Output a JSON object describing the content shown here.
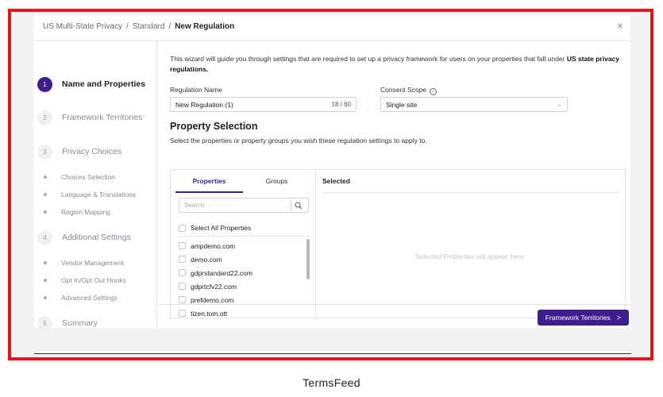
{
  "breadcrumb": {
    "item1": "US Multi-State Privacy",
    "sep": "/",
    "item2": "Standard",
    "current": "New Regulation"
  },
  "close_icon": "×",
  "steps": [
    {
      "num": "1",
      "label": "Name and Properties"
    },
    {
      "num": "2",
      "label": "Framework Territories"
    },
    {
      "num": "3",
      "label": "Privacy Choices"
    },
    {
      "num": "4",
      "label": "Additional Settings"
    },
    {
      "num": "5",
      "label": "Summary"
    }
  ],
  "substeps": {
    "privacy_choices": [
      "Choices Selection",
      "Language & Translations",
      "Region Mapping"
    ],
    "additional_settings": [
      "Vendor Management",
      "Opt In/Opt Out Hooks",
      "Advanced Settings"
    ]
  },
  "intro": {
    "text": "This wizard will guide you through settings that are required to set up a privacy framework for users on your properties that fall under ",
    "bold": "US state privacy regulations."
  },
  "regulation_name": {
    "label": "Regulation Name",
    "value": "New Regulation (1)",
    "counter": "18 / 60"
  },
  "consent_scope": {
    "label": "Consent Scope",
    "info_icon": "i",
    "value": "Single site",
    "chevron": "⌄"
  },
  "property_selection": {
    "title": "Property Selection",
    "subtitle": "Select the properties or property groups you wish these regulation settings to apply to.",
    "tabs": [
      "Properties",
      "Groups"
    ],
    "search_placeholder": "Search",
    "select_all_label": "Select All Properties",
    "properties": [
      "ampdemo.com",
      "demo.com",
      "gdprstandard22.com",
      "gdprtcfv22.com",
      "prefdemo.com",
      "tizen.tom.ott"
    ],
    "selected_header": "Selected",
    "empty_message": "Selected Properties will appear here."
  },
  "footer": {
    "next_label": "Framework Territories",
    "next_chevron": ">"
  },
  "caption": "TermsFeed",
  "colors": {
    "accent": "#3d1d8f",
    "frame": "#e4141b",
    "backdrop": "#f2f2f4"
  },
  "icons": {
    "close": "close-icon",
    "search": "search-icon",
    "info": "info-icon",
    "chevron": "chevron-down-icon",
    "next": "chevron-right-icon"
  }
}
